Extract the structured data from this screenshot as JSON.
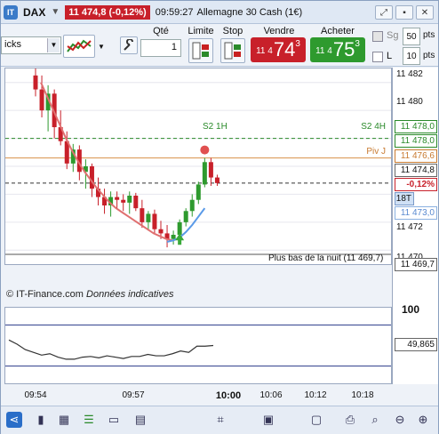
{
  "titlebar": {
    "symbol": "DAX",
    "quote": "11 474,8 (-0,12%)",
    "time": "09:59:27",
    "instrument": "Allemagne 30 Cash (1€)",
    "btn_min": "⤢",
    "btn_pin": "▪",
    "btn_close": "✕"
  },
  "toolbar": {
    "period_value": "icks",
    "qty_label": "Qté",
    "qty_value": "1",
    "limit_label": "Limite",
    "stop_label": "Stop",
    "sell_label": "Vendre",
    "sell_small": "11 4",
    "sell_big": "74",
    "sell_sup": "3",
    "buy_label": "Acheter",
    "buy_small": "11 4",
    "buy_big": "75",
    "buy_sup": "3",
    "sg_label": "Sg",
    "l_label": "L",
    "sg_value": "50",
    "l_value": "10",
    "pts_label": "pts",
    "colors": {
      "sell": "#c8202a",
      "buy": "#2e9a2e"
    }
  },
  "chart": {
    "levels": {
      "s2_1h": "S2 1H",
      "s2_4h": "S2 4H",
      "piv": "Piv J",
      "low_night": "Plus bas de la nuit (11 469,7)"
    },
    "watermark": "© IT-Finance.com",
    "watermark_note": "Données indicatives",
    "prices": {
      "p11482": "11 482",
      "p11480": "11 480",
      "p11478a": "11 478,0",
      "p11478b": "11 478,0",
      "p11476": "11 476,6",
      "p11474": "11 474,8",
      "pct": "-0,12%",
      "ticks": "18T",
      "p11473": "11 473,0",
      "p11472": "11 472",
      "p11470": "11 470",
      "p11469": "11 469,7"
    },
    "lower": {
      "top": "100",
      "value": "49,865"
    },
    "xaxis": [
      "09:54",
      "09:57",
      "10:00",
      "10:06",
      "10:12",
      "10:18"
    ]
  },
  "chart_data": {
    "type": "line",
    "title": "",
    "x": [
      "09:54",
      "09:57",
      "10:00",
      "10:06",
      "10:12",
      "10:18"
    ],
    "ylim": [
      11469,
      11483
    ],
    "candles": [
      {
        "o": 11482.5,
        "h": 11483,
        "l": 11481.0,
        "c": 11481.5
      },
      {
        "o": 11481.5,
        "h": 11482.5,
        "l": 11479.5,
        "c": 11480.0
      },
      {
        "o": 11480.0,
        "h": 11481.8,
        "l": 11478.5,
        "c": 11481.2
      },
      {
        "o": 11481.2,
        "h": 11481.5,
        "l": 11478.0,
        "c": 11478.8
      },
      {
        "o": 11478.8,
        "h": 11480.0,
        "l": 11477.5,
        "c": 11477.8
      },
      {
        "o": 11477.8,
        "h": 11478.5,
        "l": 11475.8,
        "c": 11476.2
      },
      {
        "o": 11476.2,
        "h": 11477.6,
        "l": 11475.6,
        "c": 11477.2
      },
      {
        "o": 11477.2,
        "h": 11477.5,
        "l": 11475.0,
        "c": 11475.6
      },
      {
        "o": 11475.6,
        "h": 11476.5,
        "l": 11474.4,
        "c": 11476.0
      },
      {
        "o": 11476.0,
        "h": 11476.2,
        "l": 11473.8,
        "c": 11474.4
      },
      {
        "o": 11474.4,
        "h": 11475.2,
        "l": 11473.2,
        "c": 11473.8
      },
      {
        "o": 11473.8,
        "h": 11474.4,
        "l": 11472.6,
        "c": 11473.2
      },
      {
        "o": 11473.2,
        "h": 11474.2,
        "l": 11472.4,
        "c": 11473.8
      },
      {
        "o": 11473.8,
        "h": 11474.2,
        "l": 11473.0,
        "c": 11473.6
      },
      {
        "o": 11473.6,
        "h": 11474.0,
        "l": 11472.8,
        "c": 11473.4
      },
      {
        "o": 11473.4,
        "h": 11474.2,
        "l": 11472.6,
        "c": 11473.9
      },
      {
        "o": 11473.9,
        "h": 11474.1,
        "l": 11472.8,
        "c": 11473.0
      },
      {
        "o": 11473.0,
        "h": 11473.6,
        "l": 11471.6,
        "c": 11472.0
      },
      {
        "o": 11472.0,
        "h": 11472.8,
        "l": 11471.4,
        "c": 11472.6
      },
      {
        "o": 11472.6,
        "h": 11472.9,
        "l": 11471.2,
        "c": 11471.5
      },
      {
        "o": 11471.5,
        "h": 11472.1,
        "l": 11470.8,
        "c": 11471.2
      },
      {
        "o": 11471.2,
        "h": 11471.8,
        "l": 11470.2,
        "c": 11470.8
      },
      {
        "o": 11470.8,
        "h": 11471.4,
        "l": 11470.4,
        "c": 11471.1
      },
      {
        "o": 11471.1,
        "h": 11472.2,
        "l": 11470.9,
        "c": 11472.0
      },
      {
        "o": 11472.0,
        "h": 11473.0,
        "l": 11471.7,
        "c": 11472.8
      },
      {
        "o": 11472.8,
        "h": 11474.0,
        "l": 11472.4,
        "c": 11473.6
      },
      {
        "o": 11473.6,
        "h": 11474.9,
        "l": 11473.3,
        "c": 11474.7
      },
      {
        "o": 11474.7,
        "h": 11476.6,
        "l": 11474.5,
        "c": 11476.3
      },
      {
        "o": 11476.3,
        "h": 11476.6,
        "l": 11474.6,
        "c": 11475.2
      },
      {
        "o": 11475.2,
        "h": 11475.4,
        "l": 11474.6,
        "c": 11474.8
      }
    ],
    "series": [
      {
        "values": [
          11482.0,
          11481.0,
          11480.0,
          11479.0,
          11478.0,
          11477.1,
          11476.3,
          11475.6,
          11475.0,
          11474.4,
          11473.9,
          11473.4,
          11473.0,
          11472.7,
          11472.4,
          11472.1,
          11471.8,
          11471.5,
          11471.2,
          11471.0,
          11470.8,
          11470.7
        ]
      },
      {
        "values": [
          11470.6,
          11470.7,
          11470.9,
          11471.3,
          11471.8,
          11472.4,
          11473.0
        ]
      }
    ],
    "lines": {
      "s2_1h": 11478.0,
      "s2_4h": 11478.0,
      "piv": 11476.6,
      "current": 11474.8,
      "low_night": 11469.7
    },
    "oscillator": {
      "ylim": [
        0,
        100
      ],
      "values": [
        58,
        52,
        44,
        40,
        36,
        38,
        33,
        30,
        30,
        33,
        34,
        32,
        35,
        33,
        31,
        34,
        34,
        37,
        35,
        35,
        38,
        42,
        40,
        49,
        49,
        50
      ]
    }
  }
}
